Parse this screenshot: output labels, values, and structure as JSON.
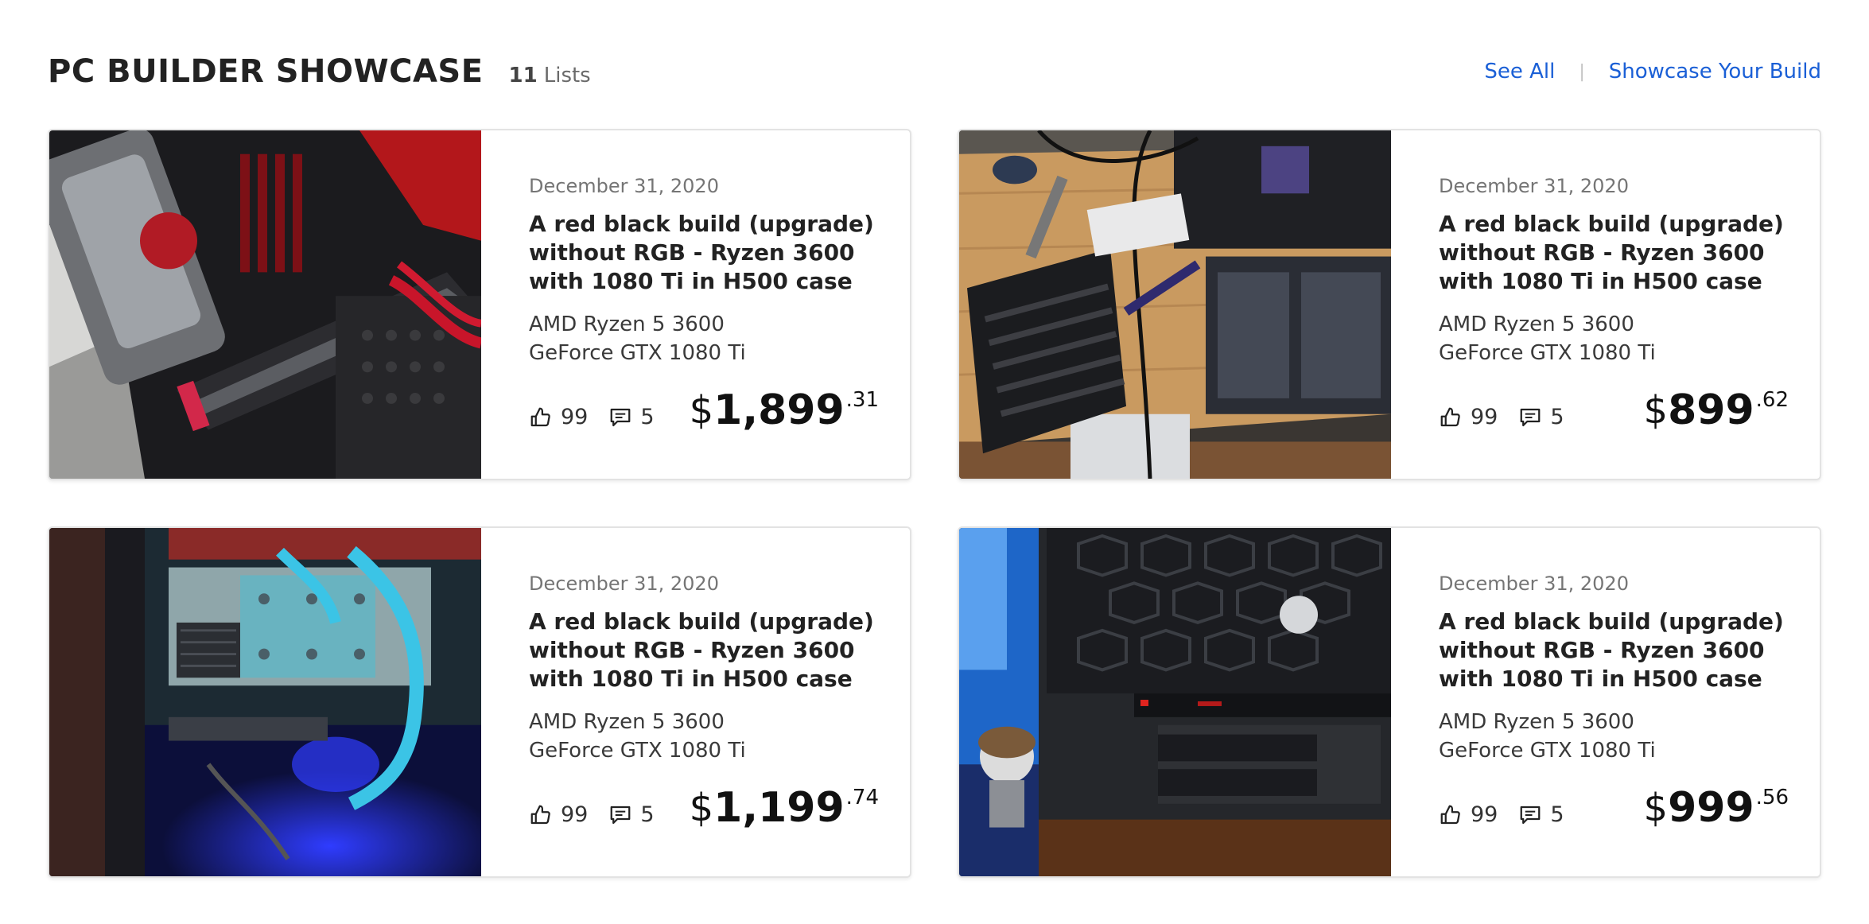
{
  "header": {
    "title": "PC BUILDER SHOWCASE",
    "list_count": "11",
    "list_count_label": "Lists",
    "see_all": "See All",
    "showcase_link": "Showcase Your Build"
  },
  "cards": [
    {
      "image_name": "red-black-msi-build-photo",
      "date": "December 31, 2020",
      "title": "A red black build (upgrade) without RGB - Ryzen 3600 with 1080 Ti in H500 case",
      "cpu": "AMD Ryzen 5 3600",
      "gpu": "GeForce GTX 1080 Ti",
      "likes": "99",
      "comments": "5",
      "price_symbol": "$",
      "price_whole": "1,899",
      "price_cents": ".31"
    },
    {
      "image_name": "desk-radiator-build-photo",
      "date": "December 31, 2020",
      "title": "A red black build (upgrade) without RGB - Ryzen 3600 with 1080 Ti in H500 case",
      "cpu": "AMD Ryzen 5 3600",
      "gpu": "GeForce GTX 1080 Ti",
      "likes": "99",
      "comments": "5",
      "price_symbol": "$",
      "price_whole": "899",
      "price_cents": ".62"
    },
    {
      "image_name": "watercooled-build-photo",
      "date": "December 31, 2020",
      "title": "A red black build (upgrade) without RGB - Ryzen 3600 with 1080 Ti in H500 case",
      "cpu": "AMD Ryzen 5 3600",
      "gpu": "GeForce GTX 1080 Ti",
      "likes": "99",
      "comments": "5",
      "price_symbol": "$",
      "price_whole": "1,199",
      "price_cents": ".74"
    },
    {
      "image_name": "cooler-master-case-photo",
      "date": "December 31, 2020",
      "title": "A red black build (upgrade) without RGB - Ryzen 3600 with 1080 Ti in H500 case",
      "cpu": "AMD Ryzen 5 3600",
      "gpu": "GeForce GTX 1080 Ti",
      "likes": "99",
      "comments": "5",
      "price_symbol": "$",
      "price_whole": "999",
      "price_cents": ".56"
    }
  ],
  "icons": {
    "like": "thumbs-up-icon",
    "comment": "comment-icon"
  },
  "colors": {
    "link": "#1a5fd6",
    "card_border": "#e3e3e3"
  }
}
